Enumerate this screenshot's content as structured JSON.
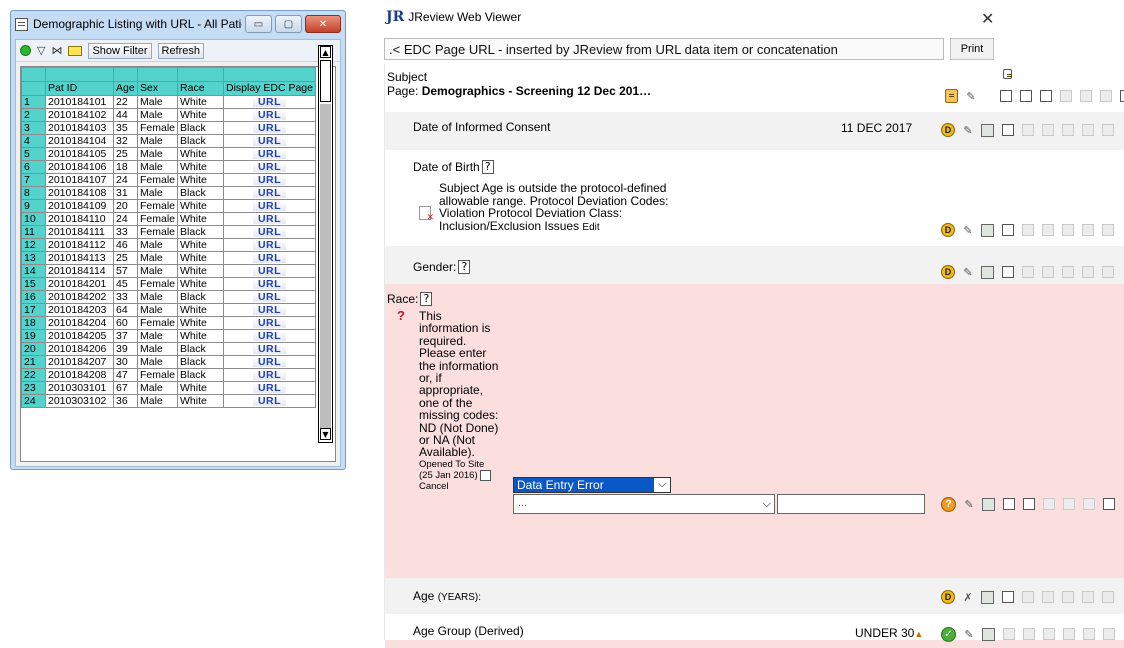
{
  "left_window": {
    "title": "Demographic Listing with URL - All Patie...",
    "controls": {
      "minimize": "▭",
      "maximize": "▢",
      "close": "✕"
    },
    "toolbar": {
      "show_filter_label": "Show Filter",
      "refresh_label": "Refresh"
    },
    "columns": [
      "Pat ID",
      "Age",
      "Sex",
      "Race",
      "Display EDC Page"
    ],
    "rows": [
      {
        "n": "1",
        "id": "2010184101",
        "age": "22",
        "sex": "Male",
        "race": "White",
        "url": "URL"
      },
      {
        "n": "2",
        "id": "2010184102",
        "age": "44",
        "sex": "Male",
        "race": "White",
        "url": "URL"
      },
      {
        "n": "3",
        "id": "2010184103",
        "age": "35",
        "sex": "Female",
        "race": "Black",
        "url": "URL"
      },
      {
        "n": "4",
        "id": "2010184104",
        "age": "32",
        "sex": "Male",
        "race": "Black",
        "url": "URL"
      },
      {
        "n": "5",
        "id": "2010184105",
        "age": "25",
        "sex": "Male",
        "race": "White",
        "url": "URL"
      },
      {
        "n": "6",
        "id": "2010184106",
        "age": "18",
        "sex": "Male",
        "race": "White",
        "url": "URL"
      },
      {
        "n": "7",
        "id": "2010184107",
        "age": "24",
        "sex": "Female",
        "race": "White",
        "url": "URL"
      },
      {
        "n": "8",
        "id": "2010184108",
        "age": "31",
        "sex": "Male",
        "race": "Black",
        "url": "URL"
      },
      {
        "n": "9",
        "id": "2010184109",
        "age": "20",
        "sex": "Female",
        "race": "White",
        "url": "URL"
      },
      {
        "n": "10",
        "id": "2010184110",
        "age": "24",
        "sex": "Female",
        "race": "White",
        "url": "URL"
      },
      {
        "n": "11",
        "id": "2010184111",
        "age": "33",
        "sex": "Female",
        "race": "Black",
        "url": "URL"
      },
      {
        "n": "12",
        "id": "2010184112",
        "age": "46",
        "sex": "Male",
        "race": "White",
        "url": "URL"
      },
      {
        "n": "13",
        "id": "2010184113",
        "age": "25",
        "sex": "Male",
        "race": "White",
        "url": "URL"
      },
      {
        "n": "14",
        "id": "2010184114",
        "age": "57",
        "sex": "Male",
        "race": "White",
        "url": "URL"
      },
      {
        "n": "15",
        "id": "2010184201",
        "age": "45",
        "sex": "Female",
        "race": "White",
        "url": "URL"
      },
      {
        "n": "16",
        "id": "2010184202",
        "age": "33",
        "sex": "Male",
        "race": "Black",
        "url": "URL"
      },
      {
        "n": "17",
        "id": "2010184203",
        "age": "64",
        "sex": "Male",
        "race": "White",
        "url": "URL"
      },
      {
        "n": "18",
        "id": "2010184204",
        "age": "60",
        "sex": "Female",
        "race": "White",
        "url": "URL"
      },
      {
        "n": "19",
        "id": "2010184205",
        "age": "37",
        "sex": "Male",
        "race": "White",
        "url": "URL"
      },
      {
        "n": "20",
        "id": "2010184206",
        "age": "39",
        "sex": "Male",
        "race": "Black",
        "url": "URL"
      },
      {
        "n": "21",
        "id": "2010184207",
        "age": "30",
        "sex": "Male",
        "race": "Black",
        "url": "URL"
      },
      {
        "n": "22",
        "id": "2010184208",
        "age": "47",
        "sex": "Female",
        "race": "Black",
        "url": "URL"
      },
      {
        "n": "23",
        "id": "2010303101",
        "age": "67",
        "sex": "Male",
        "race": "White",
        "url": "URL"
      },
      {
        "n": "24",
        "id": "2010303102",
        "age": "36",
        "sex": "Male",
        "race": "White",
        "url": "URL"
      }
    ],
    "colors": {
      "header_bg": "#54d3cc",
      "url_text": "#1d3fb5",
      "titlebar_bg": "#c4dcf4"
    }
  },
  "right_window": {
    "logo": "JR",
    "title": "JReview Web Viewer",
    "close_glyph": "✕",
    "url_text": ".< EDC Page URL - inserted by JReview from URL data item or concatenation",
    "print_label": "Print",
    "subject_label": "Subject",
    "page_prefix": "Page: ",
    "page_name": "Demographics - Screening 12 Dec 201…",
    "fields": {
      "consent": {
        "label": "Date of Informed Consent",
        "value": "11 DEC 2017"
      },
      "dob": {
        "label": "Date of Birth",
        "deviation_text": "Subject Age is outside the protocol-defined allowable range. Protocol Deviation Codes: Violation Protocol Deviation Class: Inclusion/Exclusion Issues",
        "edit_label": "Edit"
      },
      "gender": {
        "label": "Gender:"
      },
      "race": {
        "label": "Race:",
        "required_text": "This information is required. Please enter the information or, if appropriate, one of the missing codes: ND (Not Done) or NA (Not Available).",
        "opened_text": "Opened To Site (25 Jan 2016)",
        "cancel_label": "Cancel",
        "reason_select": "Data Entry Error",
        "value_select": "..."
      },
      "age": {
        "label": "Age",
        "unit": "(YEARS):"
      },
      "age_group": {
        "label": "Age Group (Derived)",
        "value": "UNDER 30"
      }
    },
    "icon_names": [
      "doc-icon",
      "data-d-icon",
      "pencil-icon",
      "note-icon",
      "query-icon",
      "check-icon",
      "help-icon",
      "error-icon"
    ],
    "colors": {
      "query_row_bg": "#fbdede",
      "grey_row_bg": "#f2f2f2",
      "select_bg": "#0a58c5",
      "logo": "#1b3f87"
    }
  }
}
